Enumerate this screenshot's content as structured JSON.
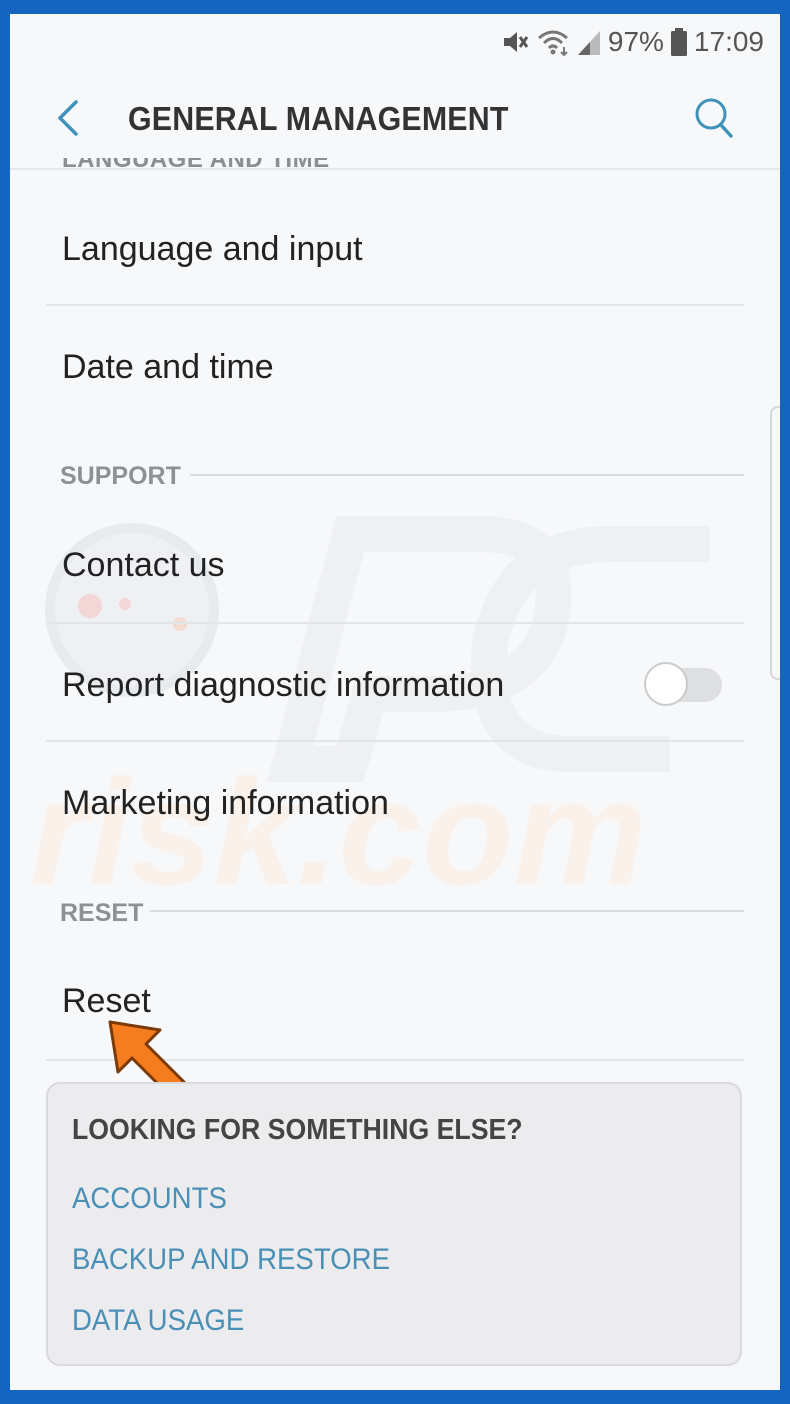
{
  "status_bar": {
    "battery_percent": "97%",
    "time": "17:09",
    "icons": [
      "mute-icon",
      "wifi-icon",
      "signal-icon",
      "battery-icon"
    ]
  },
  "header": {
    "title": "GENERAL MANAGEMENT",
    "back_icon": "back-arrow-icon",
    "search_icon": "search-icon"
  },
  "list": {
    "items": [
      {
        "label": "Language and input"
      },
      {
        "label": "Date and time"
      }
    ],
    "support": {
      "header": "SUPPORT",
      "items": [
        {
          "label": "Contact us"
        },
        {
          "label": "Report diagnostic information",
          "toggle_on": false
        },
        {
          "label": "Marketing information"
        }
      ]
    },
    "reset": {
      "header": "RESET",
      "items": [
        {
          "label": "Reset"
        }
      ]
    }
  },
  "suggestions": {
    "title": "LOOKING FOR SOMETHING ELSE?",
    "links": [
      "ACCOUNTS",
      "BACKUP AND RESTORE",
      "DATA USAGE"
    ]
  },
  "colors": {
    "accent": "#4a90b6",
    "frame": "#1565c0",
    "arrow": "#f57c1f"
  }
}
